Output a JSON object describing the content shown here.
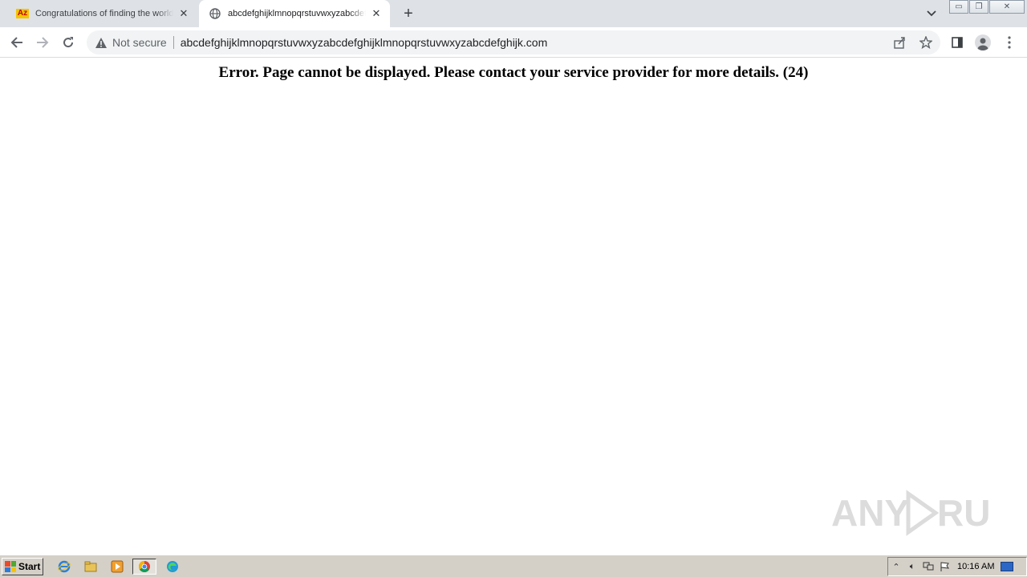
{
  "browser": {
    "tabs": [
      {
        "title": "Congratulations of finding the world's",
        "favicon": "az-icon",
        "active": false
      },
      {
        "title": "abcdefghijklmnopqrstuvwxyzabcdefghijk",
        "favicon": "globe-icon",
        "active": true
      }
    ],
    "omnibox": {
      "security_label": "Not secure",
      "url": "abcdefghijklmnopqrstuvwxyzabcdefghijklmnopqrstuvwxyzabcdefghijk.com"
    }
  },
  "page": {
    "error_message": "Error. Page cannot be displayed. Please contact your service provider for more details. (24)",
    "watermark": "ANY RUN"
  },
  "taskbar": {
    "start_label": "Start",
    "clock": "10:16 AM"
  },
  "colors": {
    "tabstrip": "#dee1e6",
    "omnibox": "#f1f3f4",
    "taskbar": "#d4d0c8"
  }
}
